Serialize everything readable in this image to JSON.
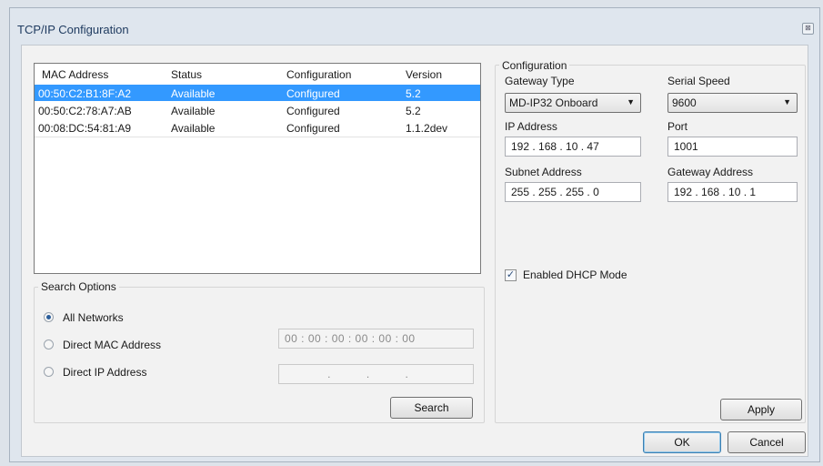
{
  "window": {
    "title": "TCP/IP  Configuration",
    "close_glyph": "⊠"
  },
  "device_list": {
    "columns": [
      "MAC Address",
      "Status",
      "Configuration",
      "Version"
    ],
    "rows": [
      {
        "mac": "00:50:C2:B1:8F:A2",
        "status": "Available",
        "configuration": "Configured",
        "version": "5.2",
        "selected": true
      },
      {
        "mac": "00:50:C2:78:A7:AB",
        "status": "Available",
        "configuration": "Configured",
        "version": "5.2",
        "selected": false
      },
      {
        "mac": "00:08:DC:54:81:A9",
        "status": "Available",
        "configuration": "Configured",
        "version": "1.1.2dev",
        "selected": false
      }
    ]
  },
  "search_options": {
    "label": "Search Options",
    "options": [
      {
        "label": "All Networks",
        "checked": true
      },
      {
        "label": "Direct MAC Address",
        "checked": false
      },
      {
        "label": "Direct IP Address",
        "checked": false
      }
    ],
    "mac_input": "00 : 00 : 00 : 00 : 00 : 00",
    "ip_input": ". . .",
    "search_button": "Search"
  },
  "configuration": {
    "label": "Configuration",
    "gateway_type_label": "Gateway Type",
    "gateway_type_value": "MD-IP32 Onboard",
    "serial_speed_label": "Serial Speed",
    "serial_speed_value": "9600",
    "ip_address_label": "IP Address",
    "ip_address_value": "192 . 168 . 10 . 47",
    "port_label": "Port",
    "port_value": "1001",
    "subnet_label": "Subnet Address",
    "subnet_value": "255 . 255 . 255 . 0",
    "gateway_address_label": "Gateway Address",
    "gateway_address_value": "192 . 168 . 10 . 1",
    "dhcp_label": "Enabled DHCP Mode",
    "dhcp_checked": true,
    "apply_button": "Apply"
  },
  "footer": {
    "ok_button": "OK",
    "cancel_button": "Cancel"
  },
  "colors": {
    "selection": "#3399ff",
    "title_text": "#1e3a5f",
    "window_bg": "#dfe6ee",
    "client_bg": "#f2f2f2"
  }
}
